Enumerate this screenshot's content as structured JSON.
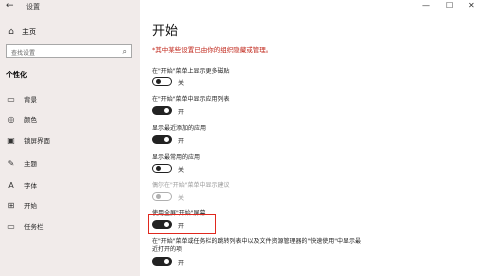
{
  "window": {
    "title": "设置",
    "back": "←",
    "minimize": "—",
    "maximize": "☐",
    "close": "✕"
  },
  "sidebar": {
    "home": "主页",
    "search_placeholder": "查找设置",
    "section": "个性化",
    "items": [
      {
        "label": "背景",
        "icon": "image-icon"
      },
      {
        "label": "颜色",
        "icon": "palette-icon"
      },
      {
        "label": "锁屏界面",
        "icon": "lockscreen-icon"
      },
      {
        "label": "主题",
        "icon": "theme-icon"
      },
      {
        "label": "字体",
        "icon": "font-icon"
      },
      {
        "label": "开始",
        "icon": "start-icon"
      },
      {
        "label": "任务栏",
        "icon": "taskbar-icon"
      }
    ]
  },
  "main": {
    "title": "开始",
    "notice": "*其中某些设置已由你的组织隐藏或管理。",
    "settings": [
      {
        "label": "在\"开始\"菜单上显示更多磁贴",
        "state": "关"
      },
      {
        "label": "在\"开始\"菜单中显示应用列表",
        "state": "开"
      },
      {
        "label": "显示最近添加的应用",
        "state": "开"
      },
      {
        "label": "显示最常用的应用",
        "state": "关"
      },
      {
        "label": "偶尔在\"开始\"菜单中显示建议",
        "state": "关"
      },
      {
        "label": "使用全屏\"开始\"屏幕",
        "state": "开"
      },
      {
        "label": "在\"开始\"菜单或任务栏的跳转列表中以及文件资源管理器的\"快速使用\"中显示最近打开的项",
        "state": "开"
      }
    ]
  }
}
